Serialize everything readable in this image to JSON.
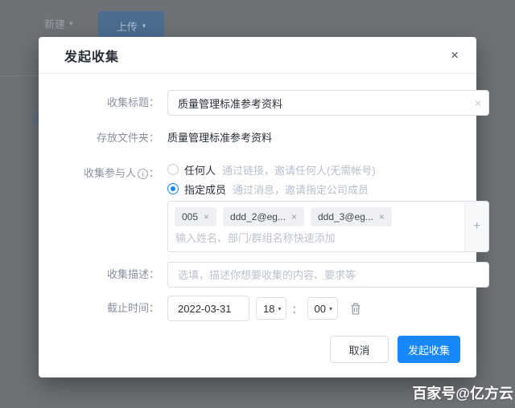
{
  "background": {
    "new_button": "新建",
    "upload_button": "上传",
    "caret": "▾"
  },
  "icons": {
    "close": "×",
    "clear": "×",
    "plus": "+",
    "info": "i",
    "caret": "▾"
  },
  "dialog": {
    "title": "发起收集",
    "fields": {
      "title": {
        "label": "收集标题：",
        "value": "质量管理标准参考资料"
      },
      "folder": {
        "label": "存放文件夹：",
        "value": "质量管理标准参考资料"
      },
      "participants": {
        "label": "收集参与人",
        "colon": "：",
        "options": [
          {
            "label": "任何人",
            "hint": "通过链接，邀请任何人(无需帐号)",
            "selected": false
          },
          {
            "label": "指定成员",
            "hint": "通过消息，邀请指定公司成员",
            "selected": true
          }
        ],
        "tags": [
          "005",
          "ddd_2@eg...",
          "ddd_3@eg..."
        ],
        "placeholder": "输入姓名、部门/群组名称快速添加"
      },
      "description": {
        "label": "收集描述：",
        "placeholder": "选填，描述你想要收集的内容、要求等"
      },
      "deadline": {
        "label": "截止时间：",
        "date": "2022-03-31",
        "hour": "18",
        "minute": "00",
        "separator": "："
      }
    },
    "footer": {
      "cancel": "取消",
      "submit": "发起收集"
    }
  },
  "watermark": "百家号@亿方云",
  "colors": {
    "primary": "#1787fa",
    "label_gray": "#8a919e",
    "hint_gray": "#b8bfcb",
    "overlay_gray": "#6e7176"
  }
}
